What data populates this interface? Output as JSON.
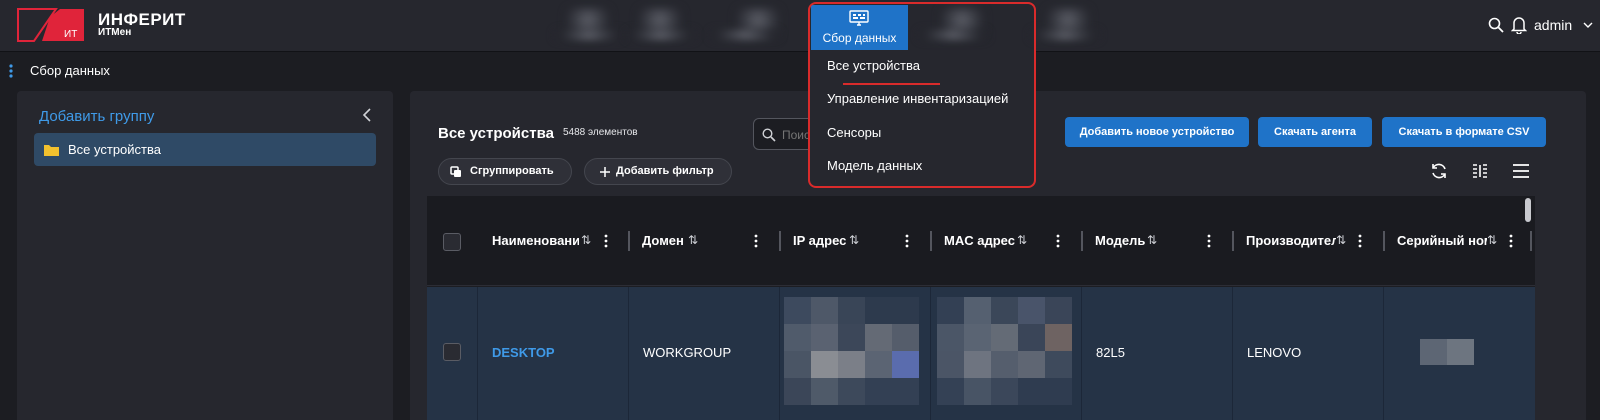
{
  "brand": {
    "title": "ИНФЕРИТ",
    "subtitle": "ИТМен",
    "logo_text": "ИТ",
    "accent": "#e0243a"
  },
  "topnav": {
    "active_label": "Сбор данных",
    "active_icon": "data-collection-icon",
    "user": "admin"
  },
  "breadcrumb": {
    "label": "Сбор данных"
  },
  "dropdown": {
    "items": [
      {
        "label": "Все устройства"
      },
      {
        "label": "Управление инвентаризацией"
      },
      {
        "label": "Сенсоры"
      },
      {
        "label": "Модель данных"
      }
    ]
  },
  "sidebar": {
    "add_group": "Добавить группу",
    "items": [
      {
        "label": "Все устройства"
      }
    ]
  },
  "main": {
    "title": "Все устройства",
    "count": "5488 элементов",
    "search_placeholder": "Поиск",
    "buttons": {
      "add_device": "Добавить новое устройство",
      "download_agent": "Скачать агента",
      "download_csv": "Скачать в формате CSV"
    },
    "group_button": "Сгруппировать",
    "add_filter_button": "Добавить фильтр"
  },
  "table": {
    "columns": [
      {
        "label": "Наименовани"
      },
      {
        "label": "Домен"
      },
      {
        "label": "IP адрес"
      },
      {
        "label": "MAC адрес"
      },
      {
        "label": "Модель"
      },
      {
        "label": "Производитель"
      },
      {
        "label": "Серийный ном"
      }
    ],
    "sort_glyph": "⇅",
    "rows": [
      {
        "name": "DESKTOP",
        "domain": "WORKGROUP",
        "ip": "",
        "mac": "",
        "model": "82L5",
        "vendor": "LENOVO",
        "serial": ""
      }
    ]
  },
  "colors": {
    "primary": "#1f73c8",
    "link": "#3f9ae8",
    "highlight": "#d92b2b"
  }
}
